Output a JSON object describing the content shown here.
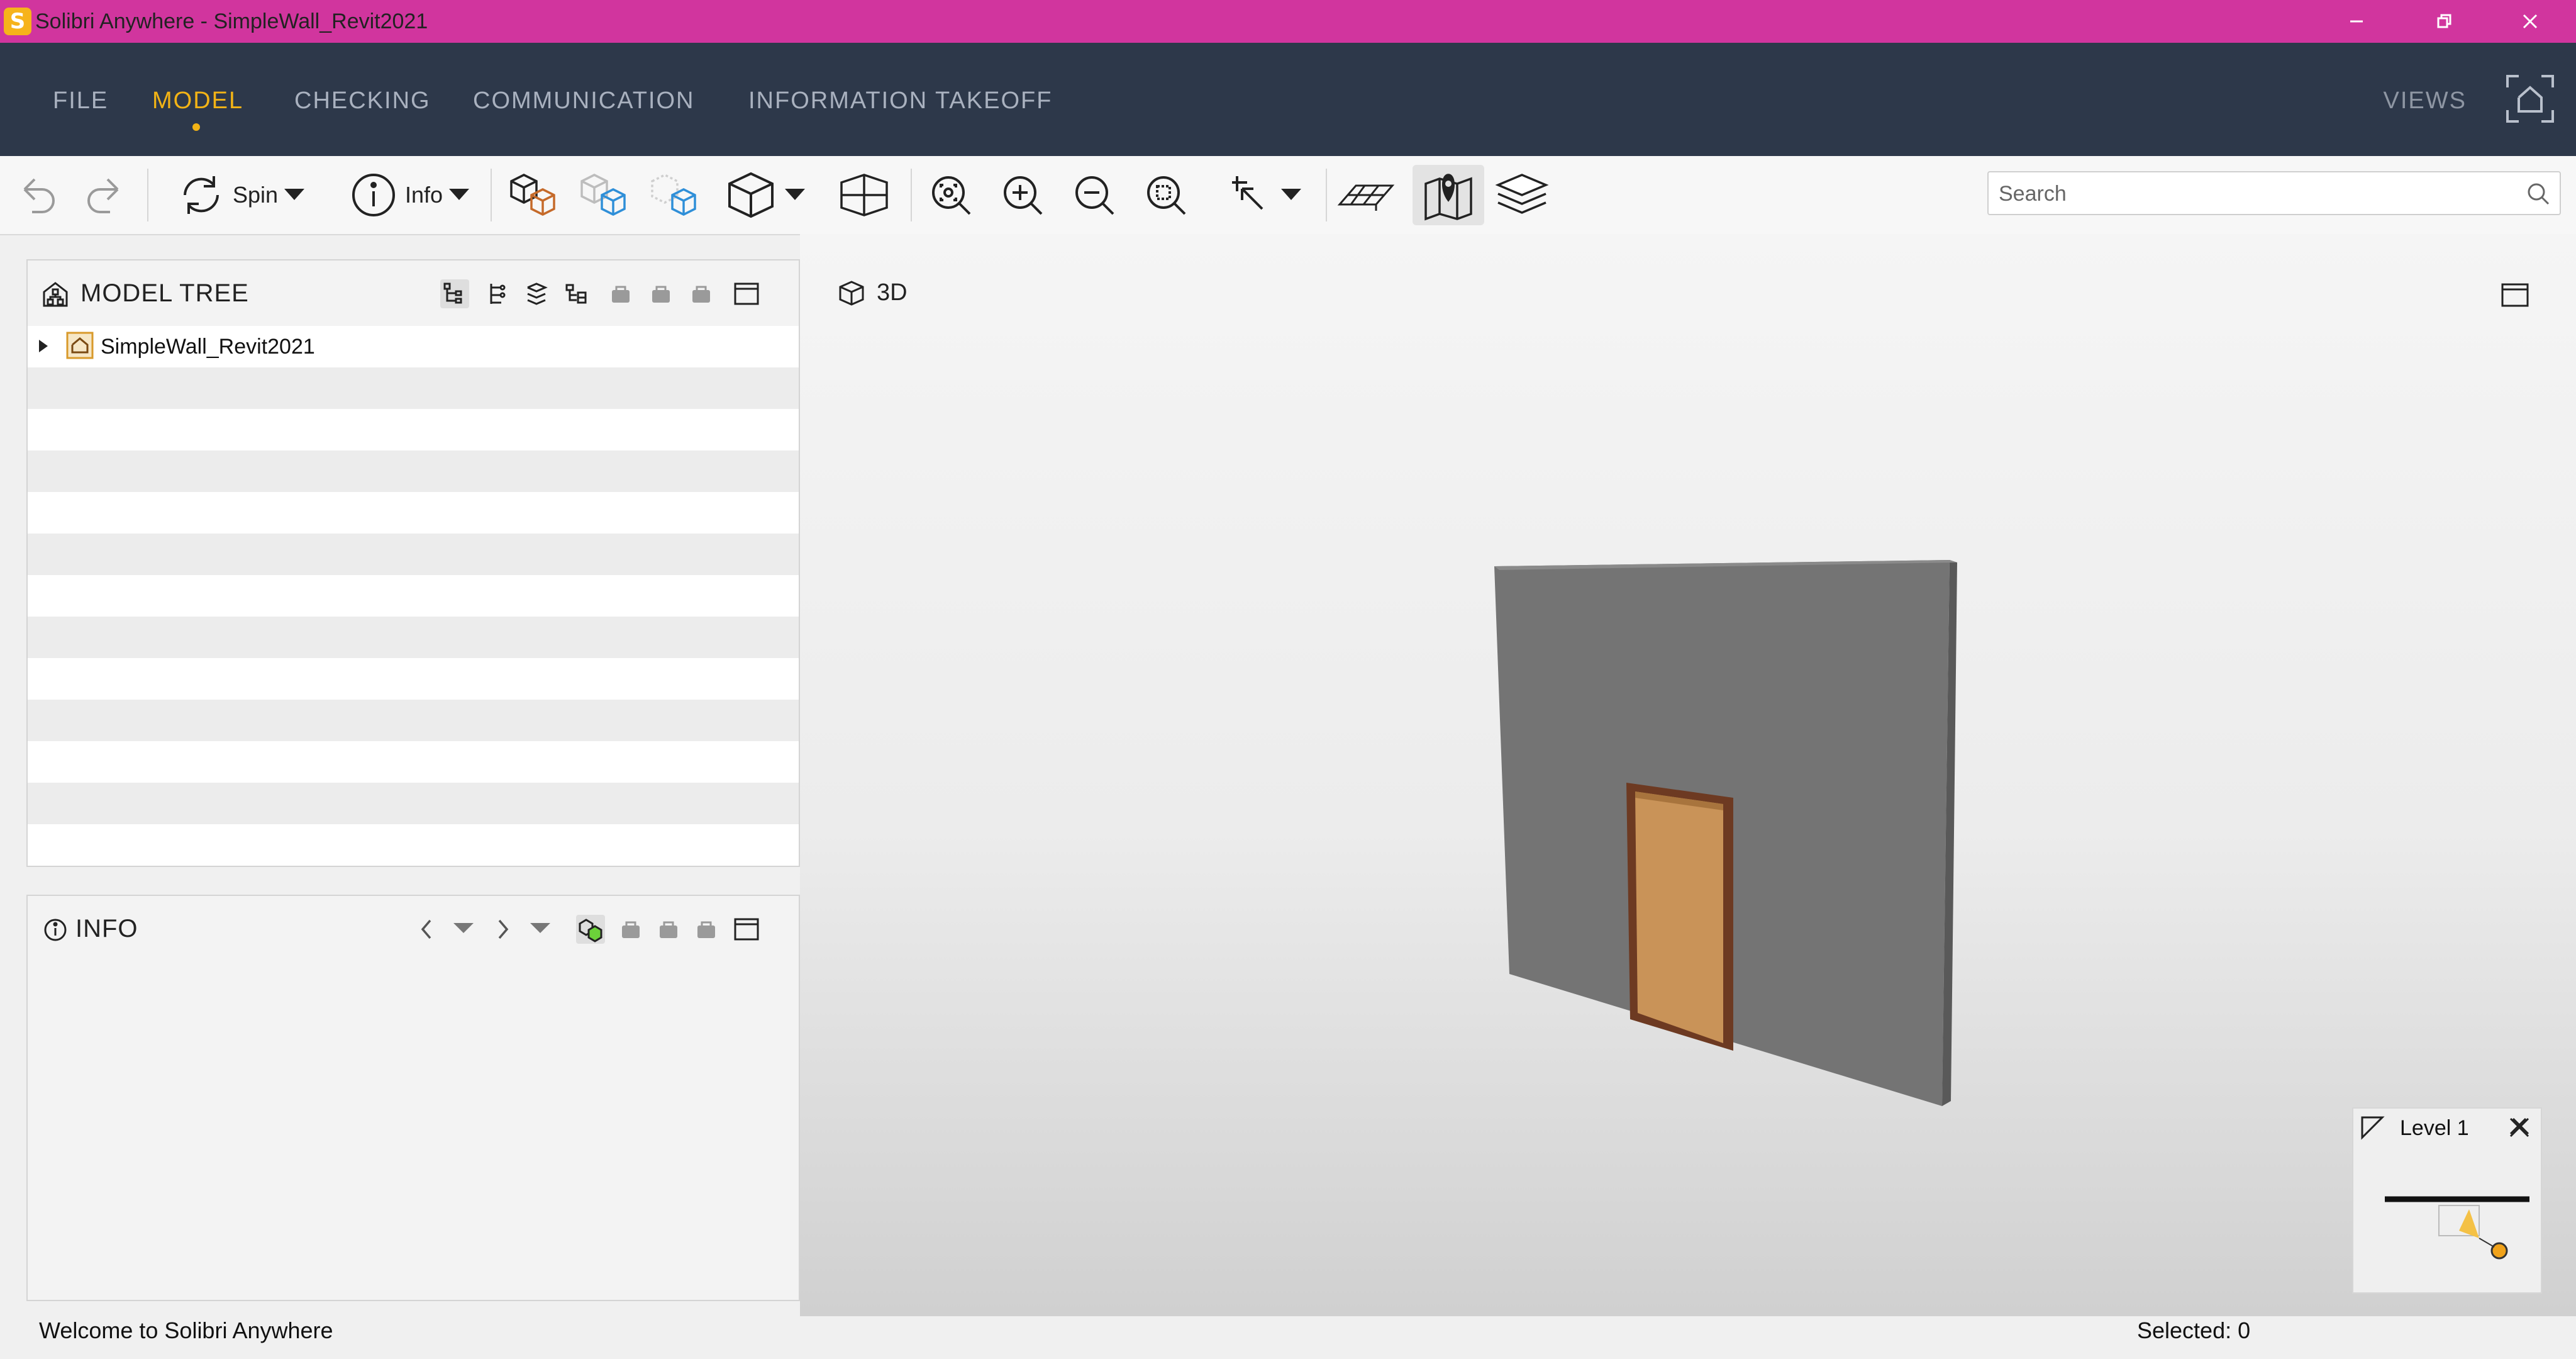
{
  "window": {
    "title": "Solibri Anywhere - SimpleWall_Revit2021",
    "logo_letter": "S",
    "accent_color": "#d1359e"
  },
  "menu": {
    "items": [
      "FILE",
      "MODEL",
      "CHECKING",
      "COMMUNICATION",
      "INFORMATION TAKEOFF"
    ],
    "active": "MODEL",
    "views_label": "VIEWS"
  },
  "toolbar": {
    "spin_label": "Spin",
    "info_label": "Info",
    "search_placeholder": "Search"
  },
  "model_tree": {
    "title": "MODEL TREE",
    "root_label": "SimpleWall_Revit2021"
  },
  "info_panel": {
    "title": "INFO"
  },
  "view": {
    "label": "3D",
    "floor_label": "Level 1"
  },
  "status": {
    "welcome": "Welcome to Solibri Anywhere",
    "selected": "Selected: 0"
  }
}
